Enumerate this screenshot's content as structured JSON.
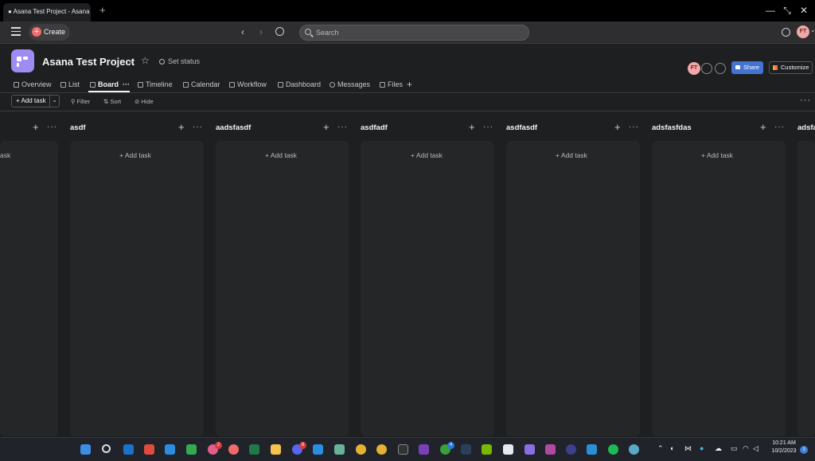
{
  "browser": {
    "tab_title": "● Asana Test Project - Asana",
    "tab_close": "✕",
    "new_tab": "+"
  },
  "topbar": {
    "create_label": "Create",
    "search_placeholder": "Search",
    "avatar_initials": "FT"
  },
  "project": {
    "title": "Asana Test Project",
    "set_status": "Set status",
    "member_initials": "FT",
    "share_label": "Share",
    "customize_label": "Customize"
  },
  "tabs": [
    {
      "label": "Overview"
    },
    {
      "label": "List"
    },
    {
      "label": "Board"
    },
    {
      "label": "Timeline"
    },
    {
      "label": "Calendar"
    },
    {
      "label": "Workflow"
    },
    {
      "label": "Dashboard"
    },
    {
      "label": "Messages"
    },
    {
      "label": "Files"
    }
  ],
  "toolbar": {
    "add_task": "Add task",
    "filter": "Filter",
    "sort": "Sort",
    "hide": "Hide"
  },
  "board": {
    "add_task": "+ Add task",
    "partial_left_label": "ask",
    "columns": [
      {
        "title": "asdf"
      },
      {
        "title": "aadsfasdf"
      },
      {
        "title": "asdfadf"
      },
      {
        "title": "asdfasdf"
      },
      {
        "title": "adsfasfdas"
      },
      {
        "title": "adsfa"
      }
    ]
  },
  "taskbar": {
    "time": "10:21 AM",
    "date": "10/2/2023",
    "notification_count": "3",
    "badge_slack": "2",
    "badge_discord": "8",
    "badge_xbox": "4"
  },
  "colors": {
    "accent_create": "#f06a6a",
    "project_icon": "#9e8cf2",
    "share": "#4573d2",
    "background": "#1e1f21"
  }
}
